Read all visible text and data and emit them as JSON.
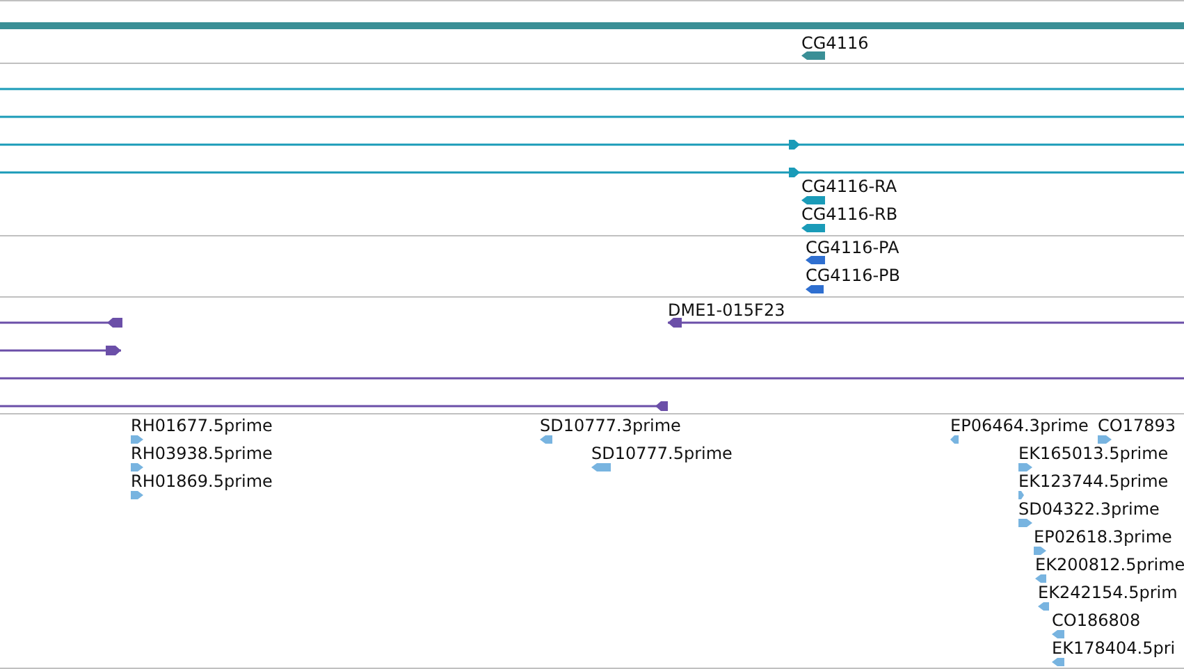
{
  "tracks": [
    {
      "color": "#3a8f96",
      "features": [
        {
          "kind": "bar"
        },
        {
          "kind": "gene",
          "label": "CG4116",
          "reverse": true
        }
      ]
    },
    {
      "color": "#1a9bb8",
      "features": [
        {
          "kind": "line"
        },
        {
          "kind": "line"
        },
        {
          "kind": "arrow_line",
          "reverse": false
        },
        {
          "kind": "arrow_line",
          "reverse": false
        },
        {
          "kind": "gene",
          "label": "CG4116-RA",
          "reverse": true
        },
        {
          "kind": "gene",
          "label": "CG4116-RB",
          "reverse": true
        }
      ]
    },
    {
      "color": "#2f6fd0",
      "features": [
        {
          "kind": "gene",
          "label": "CG4116-PA",
          "reverse": true
        },
        {
          "kind": "gene",
          "label": "CG4116-PB",
          "reverse": true
        }
      ]
    },
    {
      "color": "#6b4fa8",
      "features": [
        {
          "kind": "arrow_line",
          "reverse": true
        },
        {
          "kind": "arrow_line",
          "label": "DME1-015F23",
          "reverse": true
        },
        {
          "kind": "arrow_line",
          "reverse": false
        },
        {
          "kind": "line"
        },
        {
          "kind": "arrow_line",
          "reverse": true
        }
      ]
    },
    {
      "color": "#78b4e0",
      "features": [
        {
          "kind": "gene",
          "label": "RH01677.5prime",
          "reverse": false
        },
        {
          "kind": "gene",
          "label": "RH03938.5prime",
          "reverse": false
        },
        {
          "kind": "gene",
          "label": "RH01869.5prime",
          "reverse": false
        },
        {
          "kind": "gene",
          "label": "SD10777.3prime",
          "reverse": true
        },
        {
          "kind": "gene",
          "label": "SD10777.5prime",
          "reverse": true
        },
        {
          "kind": "gene",
          "label": "EP06464.3prime",
          "reverse": true
        },
        {
          "kind": "gene",
          "label": "CO17893",
          "reverse": false
        },
        {
          "kind": "gene",
          "label": "EK165013.5prime",
          "reverse": false
        },
        {
          "kind": "gene",
          "label": "EK123744.5prime",
          "reverse": false
        },
        {
          "kind": "gene",
          "label": "SD04322.3prime",
          "reverse": false
        },
        {
          "kind": "gene",
          "label": "EP02618.3prime",
          "reverse": false
        },
        {
          "kind": "gene",
          "label": "EK200812.5prime",
          "reverse": true
        },
        {
          "kind": "gene",
          "label": "EK242154.5prim",
          "reverse": true
        },
        {
          "kind": "gene",
          "label": "CO186808",
          "reverse": true
        },
        {
          "kind": "gene",
          "label": "EK178404.5pri",
          "reverse": true
        }
      ]
    }
  ]
}
